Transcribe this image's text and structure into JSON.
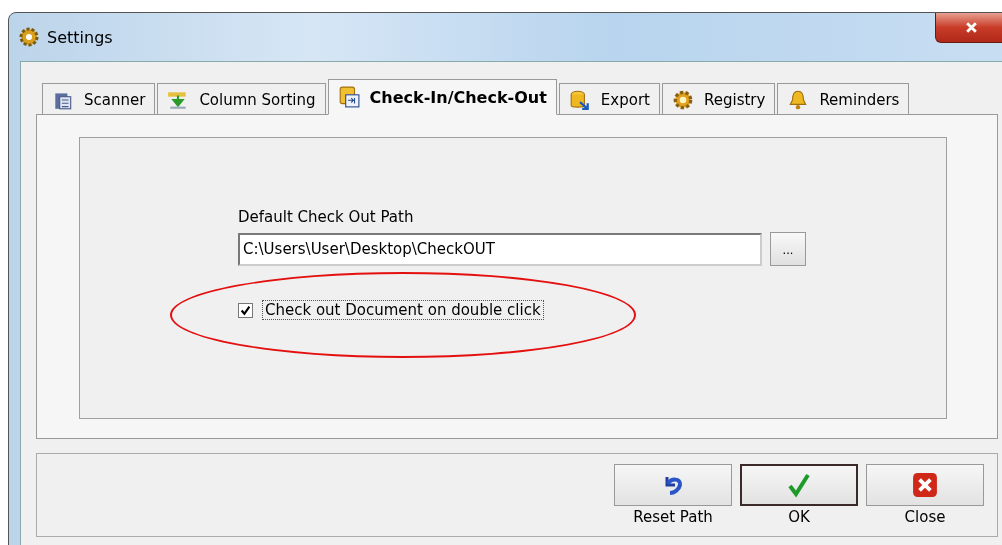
{
  "window": {
    "title": "Settings"
  },
  "tabs": [
    {
      "label": "Scanner",
      "selected": false
    },
    {
      "label": "Column Sorting",
      "selected": false
    },
    {
      "label": "Check-In/Check-Out",
      "selected": true
    },
    {
      "label": "Export",
      "selected": false
    },
    {
      "label": "Registry",
      "selected": false
    },
    {
      "label": "Reminders",
      "selected": false
    }
  ],
  "path_field": {
    "label": "Default Check Out Path",
    "value": "C:\\Users\\User\\Desktop\\CheckOUT",
    "browse": "..."
  },
  "checkbox": {
    "label": "Check out Document on double click",
    "checked": true
  },
  "buttons": [
    {
      "label": "Reset Path",
      "kind": "reset",
      "default": false
    },
    {
      "label": "OK",
      "kind": "ok",
      "default": true
    },
    {
      "label": "Close",
      "kind": "close",
      "default": false
    }
  ]
}
